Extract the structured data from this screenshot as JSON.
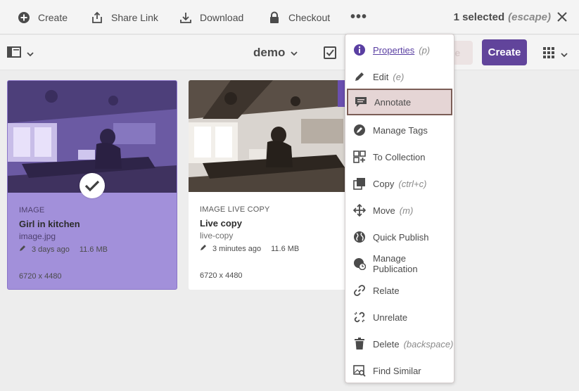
{
  "actionbar": {
    "create": "Create",
    "share_link": "Share Link",
    "download": "Download",
    "checkout": "Checkout",
    "more": "•••",
    "selected": "1 selected",
    "escape_hint": "(escape)"
  },
  "toolbar": {
    "folder": "demo",
    "ghost_button": "ne",
    "create_button": "Create"
  },
  "cards": [
    {
      "type": "IMAGE",
      "title": "Girl in kitchen",
      "filename": "image.jpg",
      "modified": "3 days ago",
      "size": "11.6 MB",
      "dimensions": "6720 x 4480",
      "selected": true
    },
    {
      "type": "IMAGE LIVE COPY",
      "title": "Live copy",
      "filename": "live-copy",
      "modified": "3 minutes ago",
      "size": "11.6 MB",
      "dimensions": "6720 x 4480",
      "badge": "New"
    }
  ],
  "menu": [
    {
      "label": "Properties",
      "shortcut": "(p)",
      "icon": "info-icon"
    },
    {
      "label": "Edit",
      "shortcut": "(e)",
      "icon": "pencil-icon"
    },
    {
      "label": "Annotate",
      "shortcut": "",
      "icon": "annotate-icon"
    },
    {
      "label": "Manage Tags",
      "shortcut": "",
      "icon": "tag-icon"
    },
    {
      "label": "To Collection",
      "shortcut": "",
      "icon": "collection-icon"
    },
    {
      "label": "Copy",
      "shortcut": "(ctrl+c)",
      "icon": "copy-icon"
    },
    {
      "label": "Move",
      "shortcut": "(m)",
      "icon": "move-icon"
    },
    {
      "label": "Quick Publish",
      "shortcut": "",
      "icon": "globe-icon"
    },
    {
      "label": "Manage Publication",
      "shortcut": "",
      "icon": "globe-clock-icon"
    },
    {
      "label": "Relate",
      "shortcut": "",
      "icon": "link-icon"
    },
    {
      "label": "Unrelate",
      "shortcut": "",
      "icon": "unlink-icon"
    },
    {
      "label": "Delete",
      "shortcut": "(backspace)",
      "icon": "trash-icon"
    },
    {
      "label": "Find Similar",
      "shortcut": "",
      "icon": "find-similar-icon"
    }
  ],
  "colors": {
    "accent": "#61449b",
    "selected_card": "#a290da",
    "menu_highlight": "#e5d5d5"
  }
}
